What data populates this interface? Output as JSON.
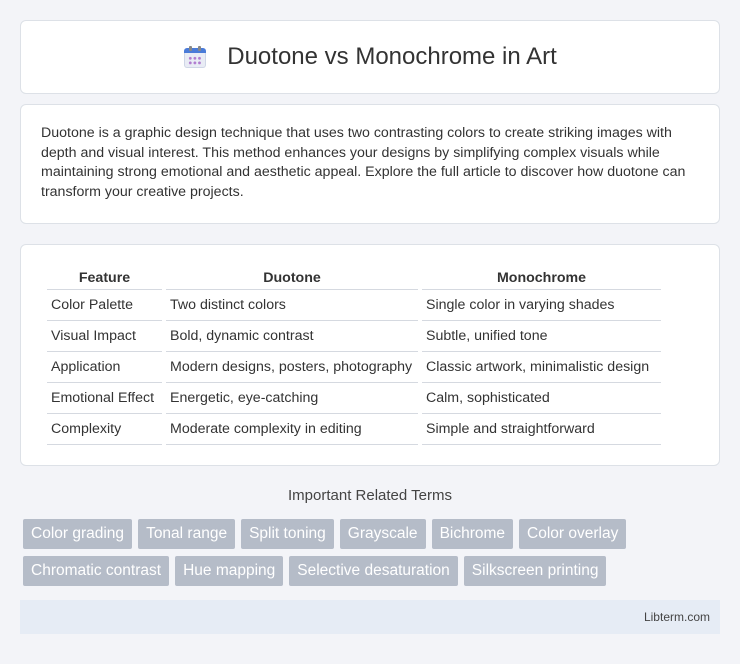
{
  "header": {
    "title": "Duotone vs Monochrome in Art",
    "icon": "calendar-icon"
  },
  "intro": {
    "text": "Duotone is a graphic design technique that uses two contrasting colors to create striking images with depth and visual interest. This method enhances your designs by simplifying complex visuals while maintaining strong emotional and aesthetic appeal. Explore the full article to discover how duotone can transform your creative projects."
  },
  "table": {
    "headers": [
      "Feature",
      "Duotone",
      "Monochrome"
    ],
    "rows": [
      [
        "Color Palette",
        "Two distinct colors",
        "Single color in varying shades"
      ],
      [
        "Visual Impact",
        "Bold, dynamic contrast",
        "Subtle, unified tone"
      ],
      [
        "Application",
        "Modern designs, posters, photography",
        "Classic artwork, minimalistic design"
      ],
      [
        "Emotional Effect",
        "Energetic, eye-catching",
        "Calm, sophisticated"
      ],
      [
        "Complexity",
        "Moderate complexity in editing",
        "Simple and straightforward"
      ]
    ]
  },
  "related": {
    "title": "Important Related Terms",
    "tags": [
      "Color grading",
      "Tonal range",
      "Split toning",
      "Grayscale",
      "Bichrome",
      "Color overlay",
      "Chromatic contrast",
      "Hue mapping",
      "Selective desaturation",
      "Silkscreen printing"
    ]
  },
  "footer": {
    "brand": "Libterm.com"
  },
  "colors": {
    "tag_bg": "#b5bcc8",
    "footer_bg": "#e6ecf5",
    "page_bg": "#f3f4f8"
  }
}
